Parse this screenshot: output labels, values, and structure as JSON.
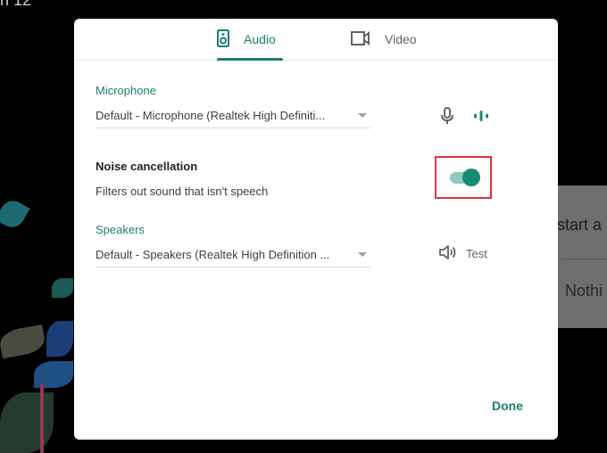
{
  "background": {
    "corner_text": "n 12",
    "side_panel": {
      "line1": "start a",
      "line2": "Nothi"
    }
  },
  "dialog": {
    "tabs": [
      {
        "label": "Audio",
        "icon": "speaker-device-icon",
        "active": true
      },
      {
        "label": "Video",
        "icon": "videocam-icon",
        "active": false
      }
    ],
    "microphone": {
      "label": "Microphone",
      "selected": "Default - Microphone (Realtek High Definiti...",
      "icons": [
        "mic-icon",
        "audio-level-icon"
      ]
    },
    "noise_cancellation": {
      "title": "Noise cancellation",
      "description": "Filters out sound that isn't speech",
      "enabled": true
    },
    "speakers": {
      "label": "Speakers",
      "selected": "Default - Speakers (Realtek High Definition ...",
      "test_label": "Test",
      "test_icon": "volume-icon"
    },
    "done_label": "Done"
  },
  "colors": {
    "accent": "#1a7f6e",
    "highlight_box": "#e0343a"
  }
}
